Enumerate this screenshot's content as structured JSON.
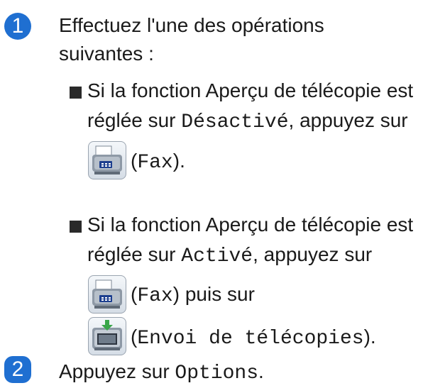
{
  "step1": {
    "number": "1",
    "line1": "Effectuez l'une des opérations",
    "line2": "suivantes :"
  },
  "bullets": [
    {
      "line1": "Si la fonction Aperçu de télécopie est",
      "line2_prefix": "réglée sur ",
      "line2_code": "Désactivé",
      "line2_suffix": ", appuyez sur",
      "icon_name": "fax-icon",
      "after_icon_open": "(",
      "after_icon_code": "Fax",
      "after_icon_close": ")."
    },
    {
      "line1": "Si la fonction Aperçu de télécopie est",
      "line2_prefix": "réglée sur ",
      "line2_code": "Activé",
      "line2_suffix": ", appuyez sur",
      "icon_name": "fax-icon",
      "after_icon_open": "(",
      "after_icon_code": "Fax",
      "after_icon_close": ") puis sur",
      "icon2_name": "sending-faxes-icon",
      "after_icon2_open": "(",
      "after_icon2_code": "Envoi de télécopies",
      "after_icon2_close": ")."
    }
  ],
  "step2": {
    "number": "2",
    "prefix": "Appuyez sur ",
    "code": "Options",
    "suffix": "."
  },
  "colors": {
    "step_badge": "#1f6fd1",
    "bullet": "#2a2a2a",
    "text": "#1a1a1a",
    "send_arrow": "#3aa64a"
  }
}
